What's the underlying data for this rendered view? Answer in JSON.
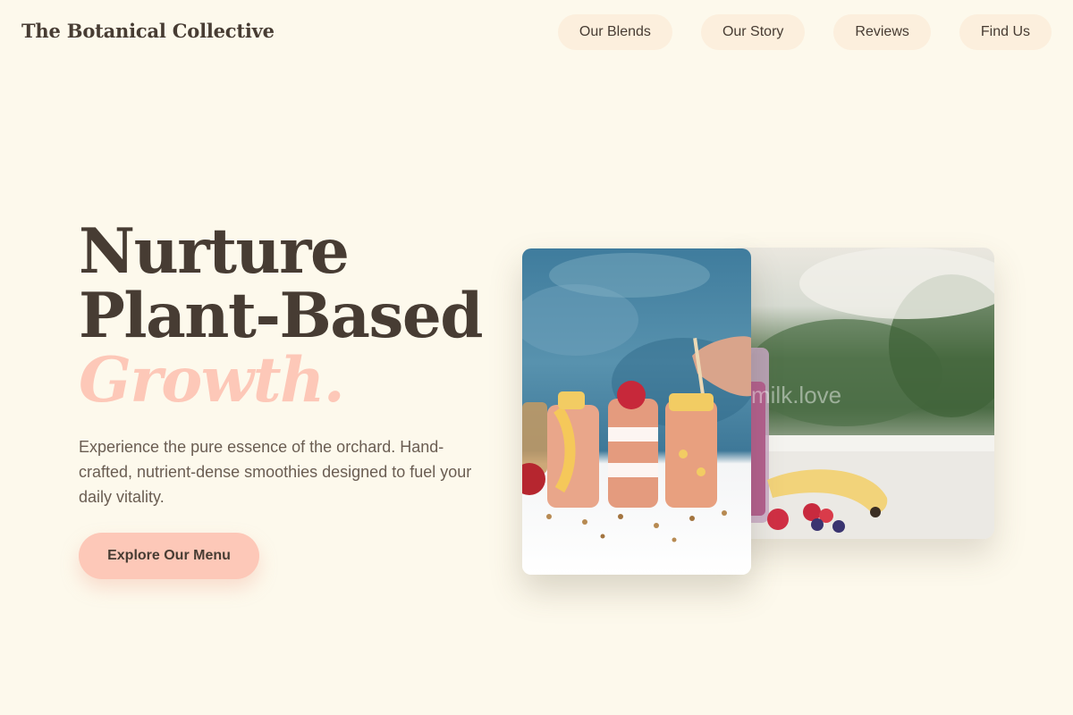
{
  "header": {
    "logo": "The Botanical Collective",
    "nav": [
      {
        "label": "Our Blends"
      },
      {
        "label": "Our Story"
      },
      {
        "label": "Reviews"
      },
      {
        "label": "Find Us"
      }
    ]
  },
  "hero": {
    "title_line1": "Nurture",
    "title_line2": "Plant-Based",
    "title_accent": "Growth.",
    "description": "Experience the pure essence of the orchard. Hand-crafted, nutrient-dense smoothies designed to fuel your daily vitality.",
    "cta_label": "Explore Our Menu"
  },
  "images": {
    "front_alt": "Three layered fruit smoothies in glasses on a white table",
    "back_alt": "Berry smoothie with banana and raspberries by a window",
    "back_watermark": "milk.love"
  },
  "colors": {
    "background": "#fdf9ec",
    "text": "#473c33",
    "accent": "#fdc8b8",
    "nav_pill": "#fcefdd"
  }
}
